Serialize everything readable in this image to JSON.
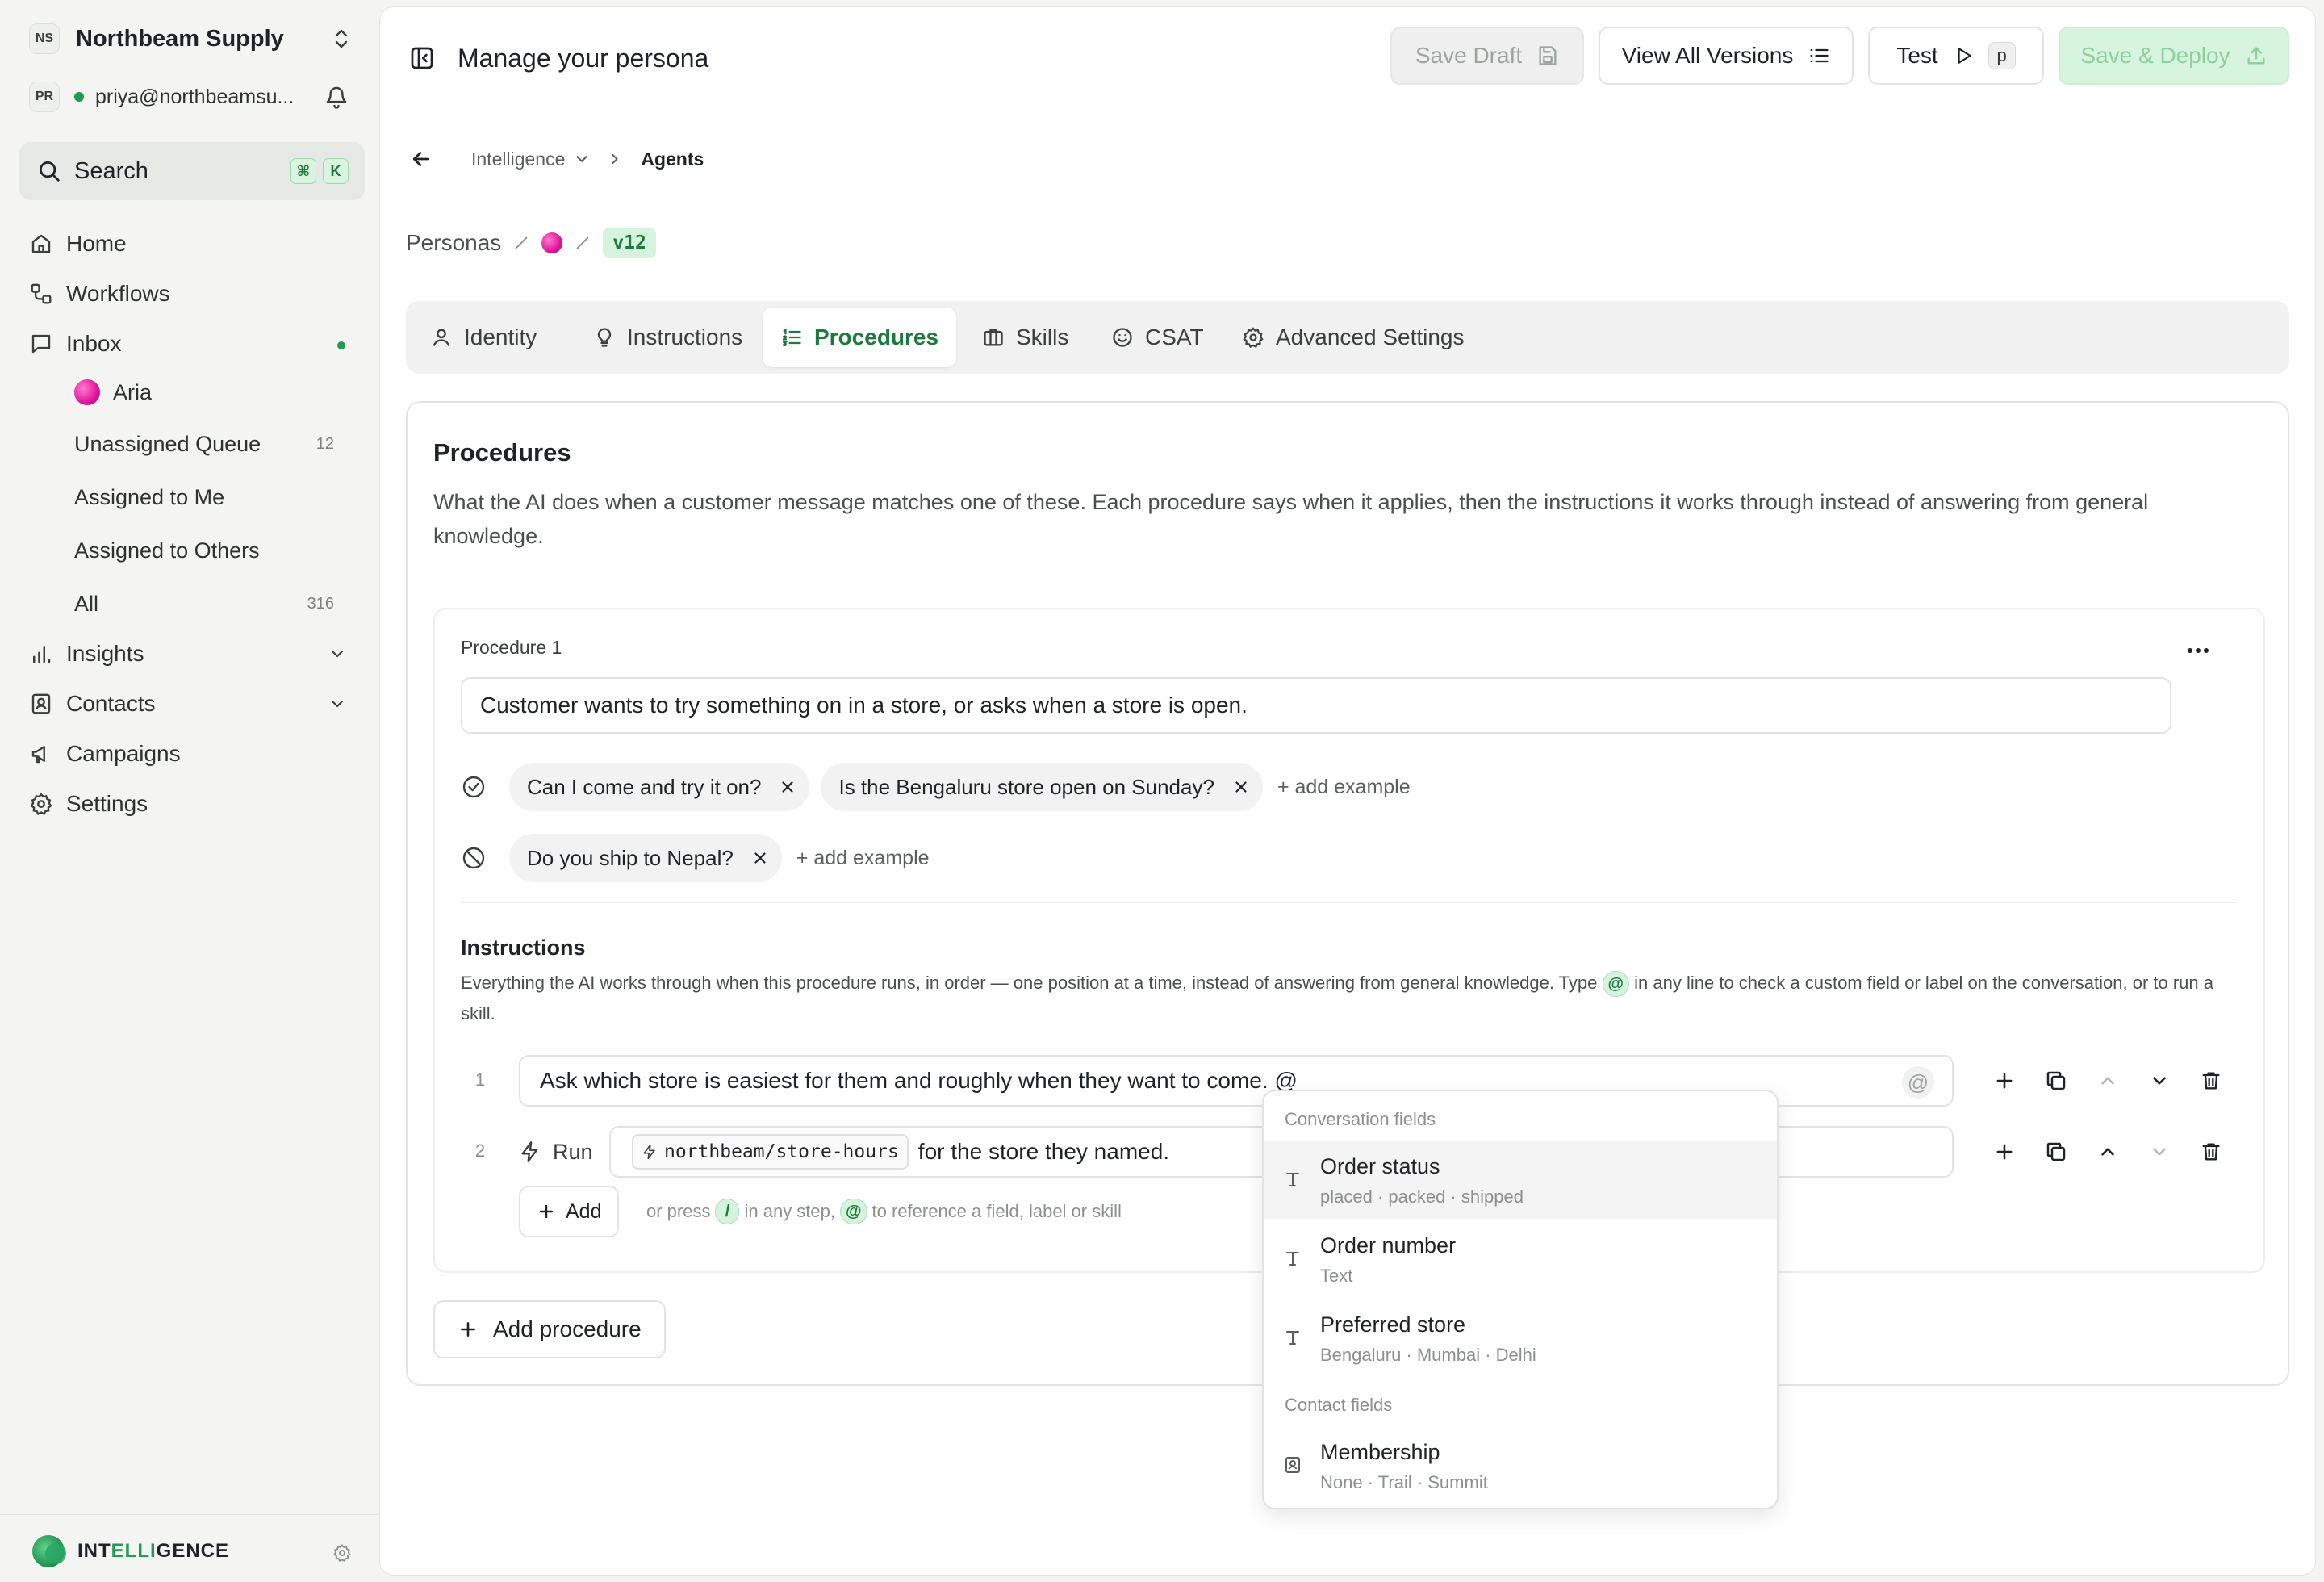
{
  "sidebar": {
    "workspace": {
      "initials": "NS",
      "name": "Northbeam Supply"
    },
    "user": {
      "initials": "PR",
      "email": "priya@northbeamsu..."
    },
    "search": {
      "label": "Search",
      "keys": [
        "⌘",
        "K"
      ]
    },
    "nav": {
      "home": "Home",
      "workflows": "Workflows",
      "inbox": "Inbox",
      "insights": "Insights",
      "contacts": "Contacts",
      "campaigns": "Campaigns",
      "settings": "Settings"
    },
    "inbox_items": [
      {
        "label": "Aria",
        "count": ""
      },
      {
        "label": "Unassigned Queue",
        "count": "12"
      },
      {
        "label": "Assigned to Me",
        "count": ""
      },
      {
        "label": "Assigned to Others",
        "count": ""
      },
      {
        "label": "All",
        "count": "316"
      }
    ],
    "brand": {
      "pre": "INT",
      "accent": "ELLI",
      "post": "GENCE"
    }
  },
  "header": {
    "title": "Manage your persona",
    "save_draft": "Save Draft",
    "view_versions": "View All Versions",
    "test": "Test",
    "test_key": "p",
    "deploy": "Save & Deploy"
  },
  "breadcrumb": {
    "parent": "Intelligence",
    "current": "Agents"
  },
  "persona_path": {
    "root": "Personas",
    "version": "v12"
  },
  "tabs": [
    "Identity",
    "Instructions",
    "Procedures",
    "Skills",
    "CSAT",
    "Advanced Settings"
  ],
  "active_tab": "Procedures",
  "procedures": {
    "title": "Procedures",
    "description": "What the AI does when a customer message matches one of these. Each procedure says when it applies, then the instructions it works through instead of answering from general knowledge.",
    "add_procedure": "Add procedure",
    "items": [
      {
        "title": "Procedure 1",
        "trigger": "Customer wants to try something on in a store, or asks when a store is open.",
        "positive_examples": [
          "Can I come and try it on?",
          "Is the Bengaluru store open on Sunday?"
        ],
        "negative_examples": [
          "Do you ship to Nepal?"
        ],
        "add_example": "+ add example",
        "instructions_title": "Instructions",
        "instructions_desc_a": "Everything the AI works through when this procedure runs, in order — one position at a time, instead of answering from general knowledge. Type",
        "instructions_desc_b": "in any line to check a custom field or label on the conversation, or to run a skill.",
        "steps": [
          {
            "num": "1",
            "text": "Ask which store is easiest for them and roughly when they want to come. @"
          },
          {
            "num": "2",
            "run_label": "Run",
            "skill": "northbeam/store-hours",
            "text": "for the store they named."
          }
        ],
        "add_step": "Add",
        "hint": {
          "a": "or press",
          "slash": "/",
          "b": "in any step,",
          "at": "@",
          "c": "to reference a field, label or skill"
        }
      }
    ]
  },
  "mention_popup": {
    "groups": [
      {
        "label": "Conversation fields",
        "options": [
          {
            "name": "Order status",
            "sub": "placed · packed · shipped",
            "icon": "text-icon"
          },
          {
            "name": "Order number",
            "sub": "Text",
            "icon": "text-icon"
          },
          {
            "name": "Preferred store",
            "sub": "Bengaluru · Mumbai · Delhi",
            "icon": "text-icon"
          }
        ]
      },
      {
        "label": "Contact fields",
        "options": [
          {
            "name": "Membership",
            "sub": "None · Trail · Summit",
            "icon": "contact-card-icon"
          }
        ]
      }
    ]
  },
  "colors": {
    "accent": "#1b7a3c",
    "accent_soft": "#d6f4dd",
    "persona": "#e0149a"
  }
}
